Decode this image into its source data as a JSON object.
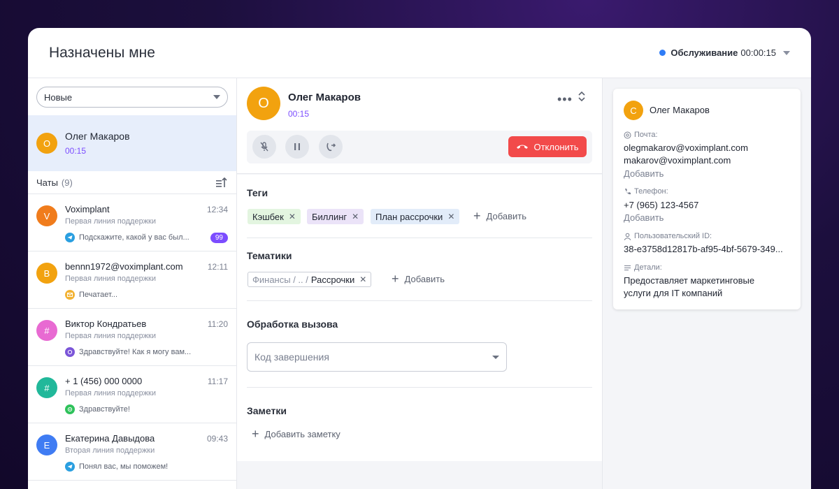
{
  "header": {
    "title": "Назначены мне",
    "status_label": "Обслуживание",
    "status_timer": "00:00:15"
  },
  "left": {
    "filter_value": "Новые",
    "active_call": {
      "initial": "О",
      "name": "Олег Макаров",
      "timer": "00:15"
    },
    "chats_label": "Чаты",
    "chats_count": "(9)",
    "chats": [
      {
        "initial": "V",
        "color": "#f07c1c",
        "name": "Voximplant",
        "time": "12:34",
        "line": "Первая линия поддержки",
        "channel": "telegram",
        "message": "Подскажите, какой у вас был...",
        "badge": "99"
      },
      {
        "initial": "B",
        "color": "#f2a20f",
        "name": "bennn1972@voximplant.com",
        "time": "12:11",
        "line": "Первая линия поддержки",
        "channel": "email",
        "message": "Печатает..."
      },
      {
        "initial": "#",
        "color": "#e86ad2",
        "name": "Виктор Кондратьев",
        "time": "11:20",
        "line": "Первая линия поддержки",
        "channel": "viber",
        "message": "Здравствуйте! Как я могу вам..."
      },
      {
        "initial": "#",
        "color": "#21b89a",
        "name": "+ 1 (456) 000 0000",
        "time": "11:17",
        "line": "Первая линия поддержки",
        "channel": "whatsapp",
        "message": "Здравствуйте!"
      },
      {
        "initial": "Е",
        "color": "#3f7cf3",
        "name": "Екатерина Давыдова",
        "time": "09:43",
        "line": "Вторая линия поддержки",
        "channel": "telegram",
        "message": "Понял вас, мы поможем!"
      }
    ]
  },
  "call": {
    "initial": "О",
    "name": "Олег Макаров",
    "timer": "00:15",
    "decline_label": "Отклонить"
  },
  "tags": {
    "title": "Теги",
    "items": [
      {
        "label": "Кэшбек",
        "color": "#e3f5e0"
      },
      {
        "label": "Биллинг",
        "color": "#ebe3f8"
      },
      {
        "label": "План рассрочки",
        "color": "#e2ecf9"
      }
    ],
    "add_label": "Добавить"
  },
  "topics": {
    "title": "Тематики",
    "path": "Финансы / .. /",
    "value": "Рассрочки",
    "add_label": "Добавить"
  },
  "processing": {
    "title": "Обработка вызова",
    "placeholder": "Код завершения"
  },
  "notes": {
    "title": "Заметки",
    "add_label": "Добавить заметку"
  },
  "contact": {
    "initial": "С",
    "name": "Олег Макаров",
    "email_label": "Почта:",
    "emails": [
      "olegmakarov@voximplant.com",
      "makarov@voximplant.com"
    ],
    "email_add": "Добавить",
    "phone_label": "Телефон:",
    "phone": "+7 (965) 123-4567",
    "phone_add": "Добавить",
    "userid_label": "Пользовательский ID:",
    "userid": "38-e3758d12817b-af95-4bf-5679-349...",
    "details_label": "Детали:",
    "details_1": "Предоставляет маркетинговые",
    "details_2": "услуги для IT компаний"
  },
  "colors": {
    "accent": "#7c4dff",
    "status_dot": "#2f7cf6",
    "decline": "#f24a4a",
    "active_bg": "#e7eefb"
  }
}
